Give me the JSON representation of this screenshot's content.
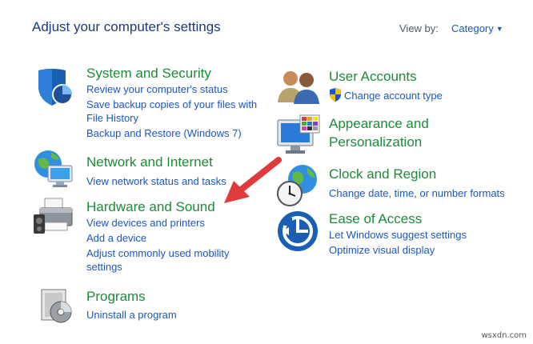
{
  "header": {
    "title": "Adjust your computer's settings",
    "view_by_label": "View by:",
    "view_by_value": "Category"
  },
  "left": {
    "system_security": {
      "title": "System and Security",
      "links": [
        "Review your computer's status",
        "Save backup copies of your files with",
        "File History",
        "Backup and Restore (Windows 7)"
      ]
    },
    "network": {
      "title": "Network and Internet",
      "links": [
        "View network status and tasks"
      ]
    },
    "hardware": {
      "title": "Hardware and Sound",
      "links": [
        "View devices and printers",
        "Add a device",
        "Adjust commonly used mobility",
        "settings"
      ]
    },
    "programs": {
      "title": "Programs",
      "links": [
        "Uninstall a program"
      ]
    }
  },
  "right": {
    "user_accounts": {
      "title": "User Accounts",
      "links": [
        "Change account type"
      ]
    },
    "appearance": {
      "title_lines": [
        "Appearance and",
        "Personalization"
      ]
    },
    "clock": {
      "title": "Clock and Region",
      "links": [
        "Change date, time, or number formats"
      ]
    },
    "ease": {
      "title": "Ease of Access",
      "links": [
        "Let Windows suggest settings",
        "Optimize visual display"
      ]
    }
  },
  "watermark": "wsxdn.com",
  "colors": {
    "category_green": "#1c8a3a",
    "link_blue": "#1c56c4",
    "title_navy": "#1e3a7a",
    "arrow_red": "#e03a3a"
  },
  "icons": [
    "shield-icon",
    "network-globe-icon",
    "printer-speaker-icon",
    "programs-disc-icon",
    "users-icon",
    "uac-shield-icon",
    "appearance-monitor-icon",
    "clock-globe-icon",
    "ease-of-access-icon",
    "red-arrow-annotation"
  ]
}
